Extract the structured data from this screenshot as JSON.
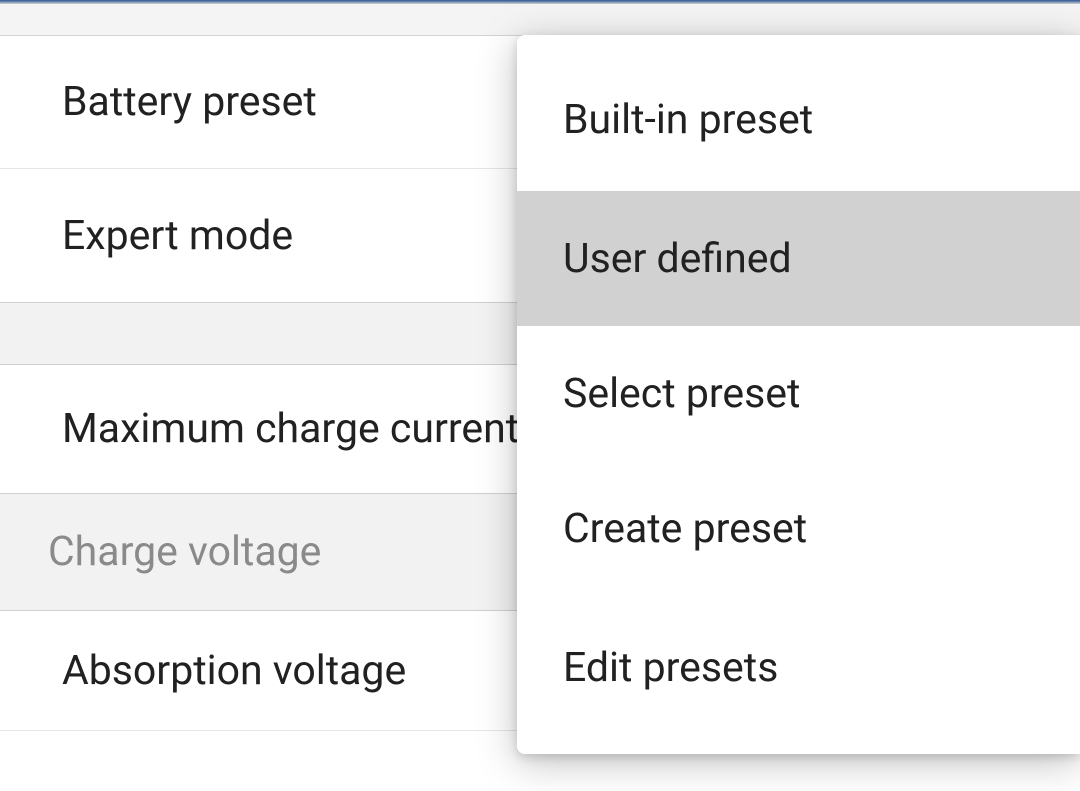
{
  "settings": {
    "battery_preset_label": "Battery preset",
    "expert_mode_label": "Expert mode",
    "max_charge_current_label": "Maximum charge current",
    "charge_voltage_header": "Charge voltage",
    "absorption_voltage_label": "Absorption voltage"
  },
  "menu": {
    "builtin": "Built-in preset",
    "user_defined": "User defined",
    "select_preset": "Select preset",
    "create_preset": "Create preset",
    "edit_presets": "Edit presets"
  }
}
